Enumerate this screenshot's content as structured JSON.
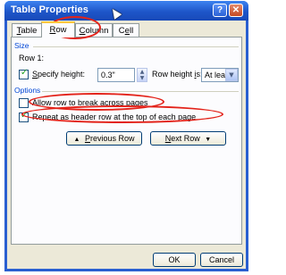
{
  "window": {
    "title": "Table Properties",
    "help_symbol": "?",
    "close_symbol": "✕"
  },
  "tabs": [
    {
      "label": "Table",
      "key": "T",
      "rest": "able"
    },
    {
      "label": "Row",
      "key": "R",
      "rest": "ow"
    },
    {
      "label": "Column",
      "key": "C",
      "rest": "olumn"
    },
    {
      "label": "Cell",
      "key": "E",
      "pre": "C",
      "rest": "ll"
    }
  ],
  "size": {
    "group_label": "Size",
    "row_label": "Row 1:",
    "specify_height_pre": "",
    "specify_height_key": "S",
    "specify_height_post": "pecify height:",
    "specify_height_checked": true,
    "height_value": "0.3\"",
    "row_height_is_pre": "Row height ",
    "row_height_is_key": "i",
    "row_height_is_post": "s:",
    "row_height_mode": "At least"
  },
  "options": {
    "group_label": "Options",
    "allow_break_pre": "Allow row to brea",
    "allow_break_key": "k",
    "allow_break_post": " across pages",
    "allow_break_checked": false,
    "repeat_header_pre": "Repeat as ",
    "repeat_header_key": "h",
    "repeat_header_post": "eader row at the top of each page",
    "repeat_header_checked": true
  },
  "nav": {
    "prev_icon": "▲",
    "prev_key": "P",
    "prev_rest": "revious Row",
    "next_key": "N",
    "next_rest": "ext Row",
    "next_icon": "▼"
  },
  "footer": {
    "ok_label": "OK",
    "cancel_label": "Cancel"
  },
  "colors": {
    "titlebar": "#1e56c9",
    "dialog_bg": "#ece9d8",
    "group_label": "#0046d5",
    "highlight": "#e32219"
  }
}
